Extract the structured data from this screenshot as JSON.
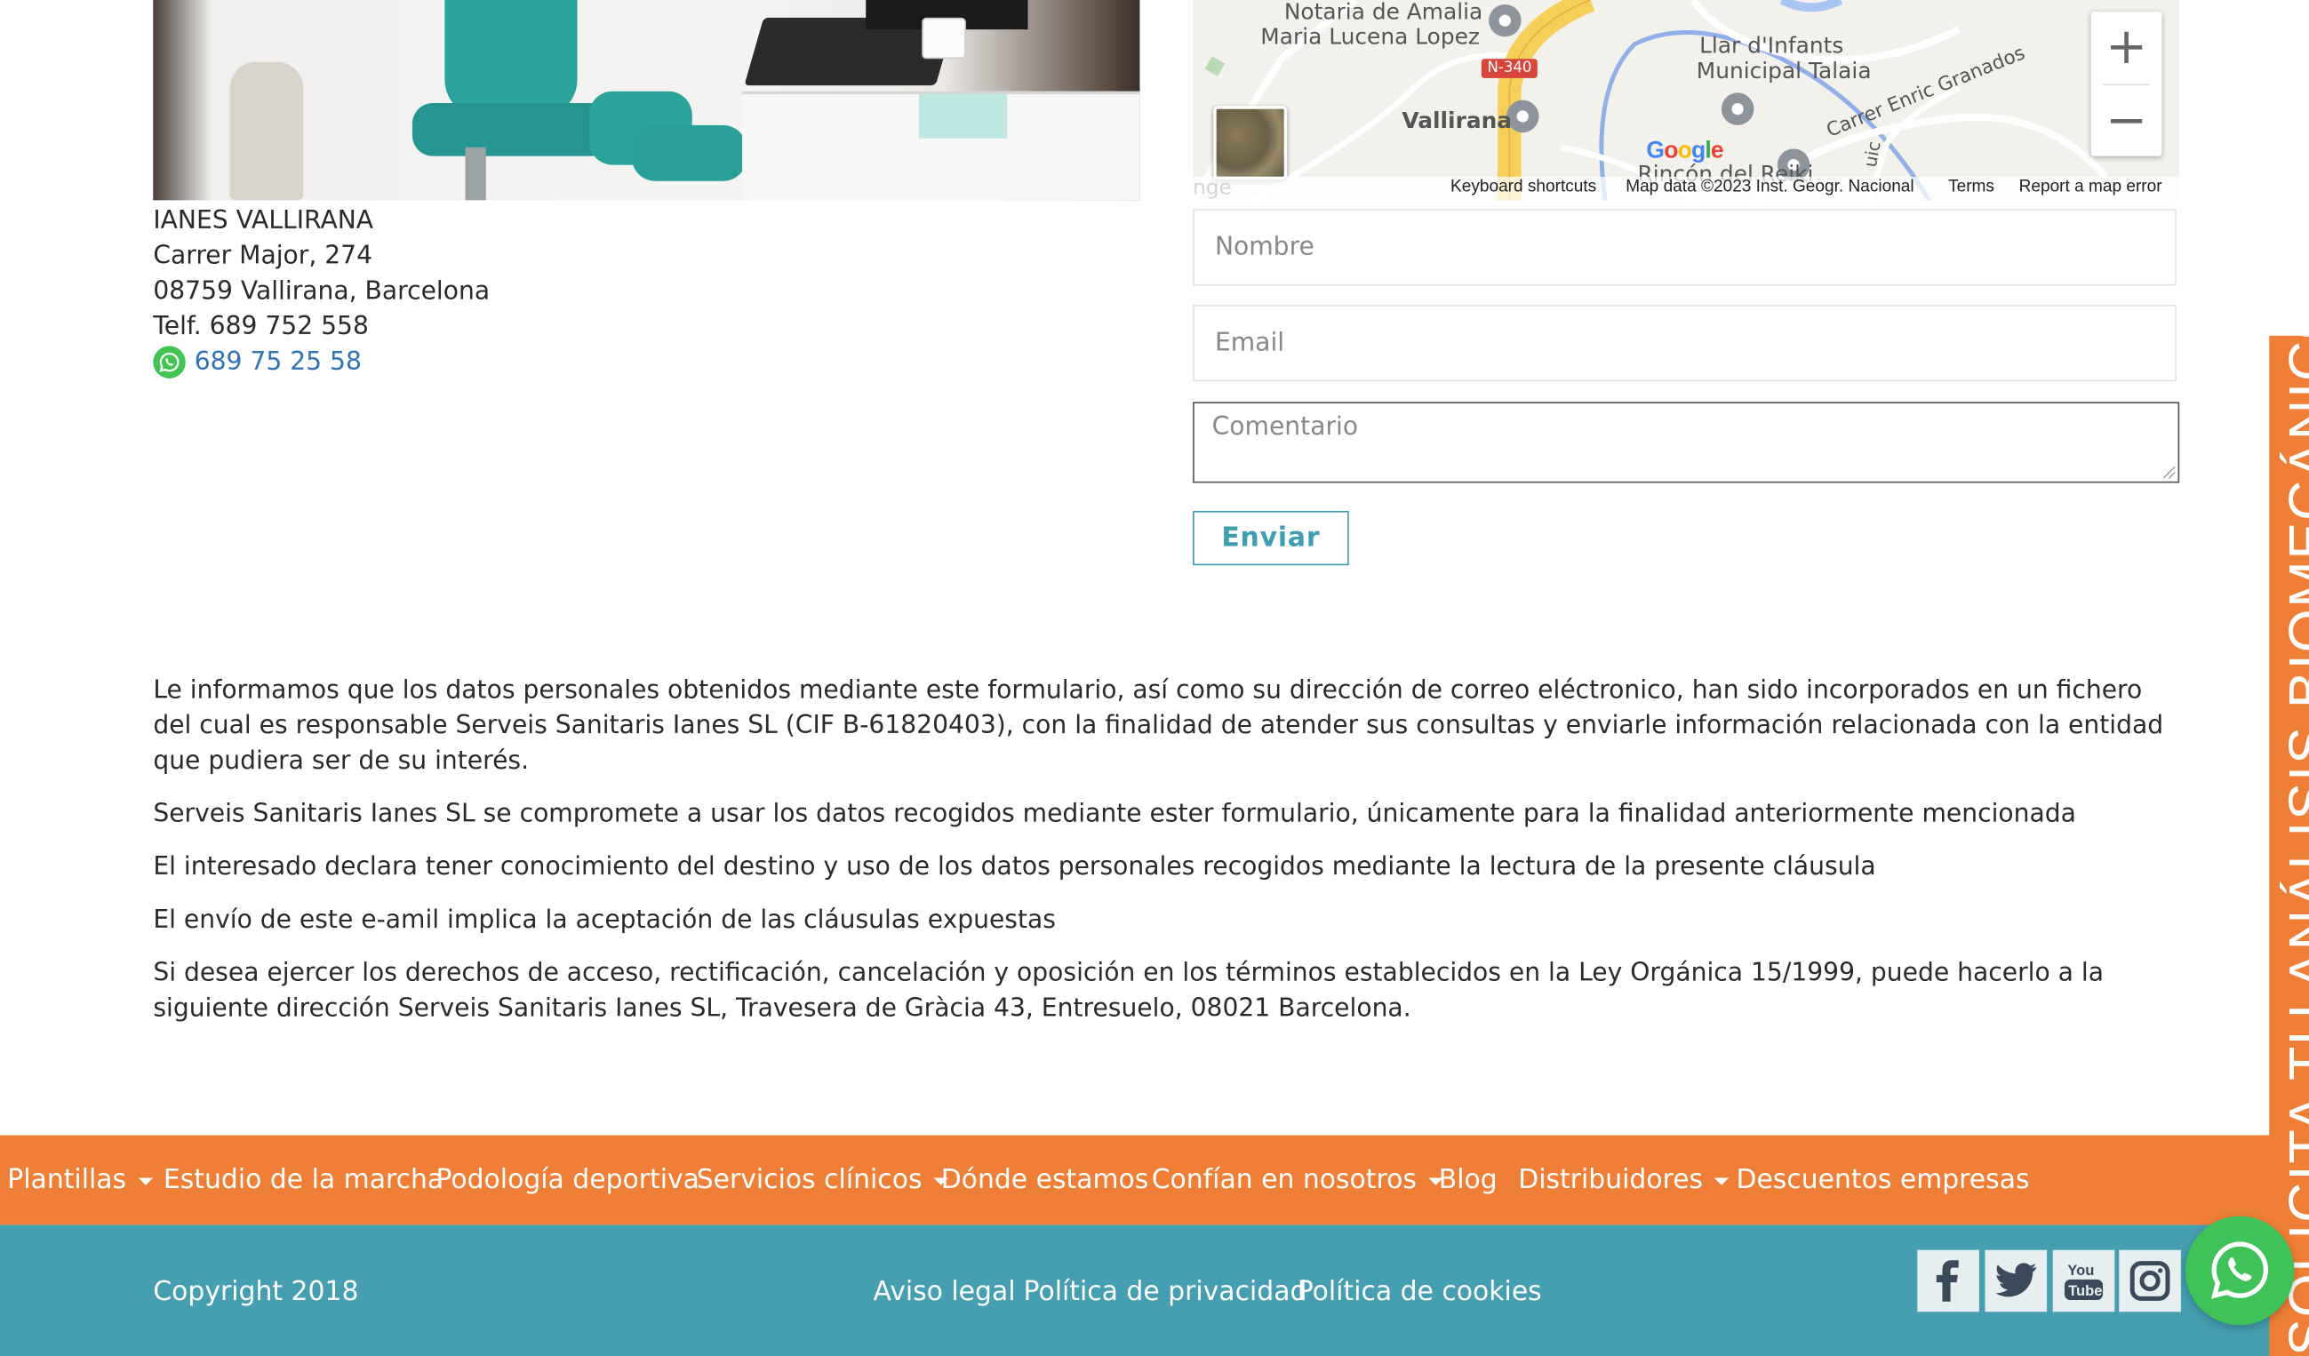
{
  "contact": {
    "name": "IANES VALLIRANA",
    "street": "Carrer Major, 274",
    "city": "08759 Vallirana, Barcelona",
    "phone": "Telf. 689 752 558",
    "whatsapp": "689 75 25 58"
  },
  "map": {
    "labels": {
      "notaria_1": "Notaria de Amalia",
      "notaria_2": "Maria Lucena Lopez",
      "llar_1": "Llar d'Infants",
      "llar_2": "Municipal Talaia",
      "vallirana": "Vallirana",
      "road": "N-340",
      "granados": "Carrer Enric Granados",
      "rincon": "Rincón del Reiki",
      "edge_left": "nge",
      "edge_right": "uic"
    },
    "google": "Google",
    "attribution": {
      "shortcuts": "Keyboard shortcuts",
      "data": "Map data ©2023 Inst. Geogr. Nacional",
      "terms": "Terms",
      "report": "Report a map error"
    },
    "zoom_in": "+",
    "zoom_out": "−"
  },
  "form": {
    "name_placeholder": "Nombre",
    "email_placeholder": "Email",
    "comment_placeholder": "Comentario",
    "submit": "Enviar"
  },
  "legal": {
    "p1": "Le informamos que los datos personales obtenidos mediante este formulario, así como su dirección de correo eléctronico, han sido incorporados en un fichero del cual es responsable Serveis Sanitaris Ianes SL (CIF B-61820403), con la finalidad de atender sus consultas y enviarle información relacionada con la entidad que pudiera ser de su interés.",
    "p2": "Serveis Sanitaris Ianes SL se compromete a usar los datos recogidos mediante ester formulario, únicamente para la finalidad anteriormente mencionada",
    "p3": "El interesado declara tener conocimiento del destino y uso de los datos personales recogidos mediante la lectura de la presente cláusula",
    "p4": "El envío de este e-amil implica la aceptación de las cláusulas expuestas",
    "p5": "Si desea ejercer los derechos de acceso, rectificación, cancelación y oposición en los términos establecidos en la Ley Orgánica 15/1999, puede hacerlo a la siguiente dirección Serveis Sanitaris Ianes SL, Travesera de Gràcia 43, Entresuelo, 08021 Barcelona."
  },
  "nav": {
    "items": [
      {
        "label": "Plantillas",
        "dropdown": true
      },
      {
        "label": "Estudio de la marcha",
        "dropdown": false
      },
      {
        "label": "Podología deportiva",
        "dropdown": false
      },
      {
        "label": "Servicios clínicos",
        "dropdown": true
      },
      {
        "label": "Dónde estamos",
        "dropdown": false
      },
      {
        "label": "Confían en nosotros",
        "dropdown": true
      },
      {
        "label": "Blog",
        "dropdown": false
      },
      {
        "label": "Distribuidores",
        "dropdown": true
      },
      {
        "label": "Descuentos empresas",
        "dropdown": false
      }
    ]
  },
  "footer": {
    "copyright": "Copyright 2018",
    "links": [
      "Aviso legal",
      "Política de privacidad",
      "Política de cookies"
    ],
    "social": [
      "facebook-icon",
      "twitter-icon",
      "youtube-icon",
      "instagram-icon"
    ]
  },
  "side_tab": {
    "label": "SOLICITA TU ANÁLISIS BIOMECÁNICO"
  },
  "colors": {
    "accent_orange": "#ef7f36",
    "footer_teal": "#469fb1",
    "link_blue": "#2e74b5",
    "button_teal": "#3f9db2",
    "whatsapp_green": "#3fc257"
  }
}
